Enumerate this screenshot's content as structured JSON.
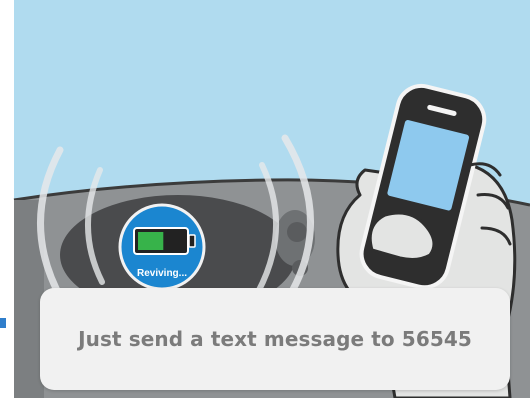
{
  "scene": {
    "battery_badge": {
      "label": "Reviving...",
      "charge_fraction": 0.55,
      "badge_color": "#1b86d0",
      "charge_color": "#37b34a"
    },
    "phone": {
      "screen_color": "#8ec9ee",
      "body_color": "#2e2e2e"
    },
    "sky_color": "#b0dbef",
    "car_interior_color": "#8f9294"
  },
  "caption": {
    "text": "Just send a text message to 56545"
  }
}
